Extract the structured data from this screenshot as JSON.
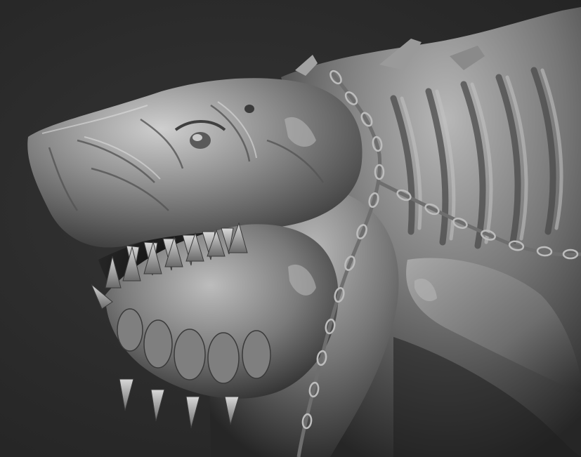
{
  "image": {
    "subject": "sculpt-render",
    "background_color": "#2a2a2a",
    "clay_color": "#8c8c8c",
    "highlight_color": "#d2d2d2",
    "shadow_color": "#1a1a1a"
  }
}
